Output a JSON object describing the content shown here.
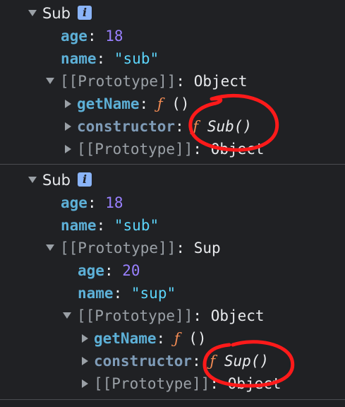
{
  "block1": {
    "object_name": "Sub",
    "info_icon": "info-icon",
    "age_key": "age",
    "age_value": "18",
    "name_key": "name",
    "name_value": "\"sub\"",
    "proto_key": "[[Prototype]]",
    "proto_value": "Object",
    "getName_key": "getName",
    "getName_value": "()",
    "constructor_key": "constructor",
    "constructor_value": "Sub()",
    "inner_proto_key": "[[Prototype]]",
    "inner_proto_value": "Object"
  },
  "block2": {
    "object_name": "Sub",
    "info_icon": "info-icon",
    "age_key": "age",
    "age_value": "18",
    "name_key": "name",
    "name_value": "\"sub\"",
    "proto_key": "[[Prototype]]",
    "proto_value": "Sup",
    "sup_age_key": "age",
    "sup_age_value": "20",
    "sup_name_key": "name",
    "sup_name_value": "\"sup\"",
    "sup_proto_key": "[[Prototype]]",
    "sup_proto_value": "Object",
    "getName_key": "getName",
    "getName_value": "()",
    "constructor_key": "constructor",
    "constructor_value": "Sup()",
    "inner_proto_key": "[[Prototype]]",
    "inner_proto_value": "Object"
  },
  "symbols": {
    "f": "ƒ",
    "colon": ":"
  },
  "colors": {
    "background": "#202124",
    "key": "#5db0d7",
    "number": "#9980ff",
    "string": "#5cd5fb",
    "function_symbol": "#f28b54",
    "annotation": "#ff1a1a"
  }
}
